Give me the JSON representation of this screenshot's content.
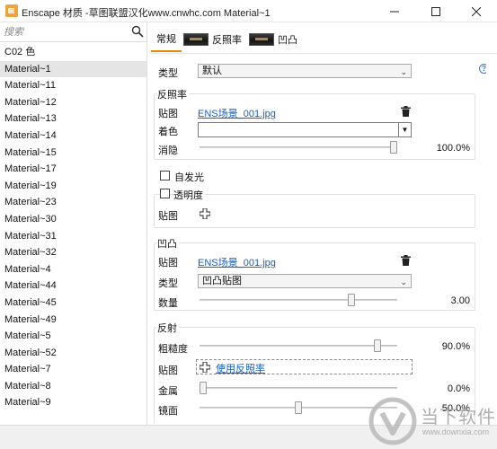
{
  "window": {
    "title": "Enscape 材质 -草图联盟汉化www.cnwhc.com Material~1"
  },
  "search": {
    "placeholder": "搜索"
  },
  "materials": [
    "C02 色",
    "Material~1",
    "Material~11",
    "Material~12",
    "Material~13",
    "Material~14",
    "Material~15",
    "Material~17",
    "Material~19",
    "Material~23",
    "Material~30",
    "Material~31",
    "Material~32",
    "Material~4",
    "Material~44",
    "Material~45",
    "Material~49",
    "Material~5",
    "Material~52",
    "Material~7",
    "Material~8",
    "Material~9"
  ],
  "selected_material": "Material~1",
  "tabs": {
    "general": "常规",
    "reflectivity": "反照率",
    "bump": "凹凸"
  },
  "type_row": {
    "label": "类型",
    "value": "默认"
  },
  "albedo": {
    "title": "反照率",
    "texture_label": "贴图",
    "texture_file": "ENS场景_001.jpg",
    "tint_label": "着色",
    "fade_label": "消隐",
    "fade_value": "100.0%",
    "fade_level": 1.0
  },
  "self_illumination": {
    "label": "自发光"
  },
  "transparency": {
    "label": "透明度",
    "texture_label": "贴图"
  },
  "bump": {
    "title": "凹凸",
    "texture_label": "贴图",
    "texture_file": "ENS场景_001.jpg",
    "type_label": "类型",
    "type_value": "凹凸贴图",
    "amount_label": "数量",
    "amount_value": "3.00",
    "amount_level": 0.77
  },
  "reflection": {
    "title": "反射",
    "roughness_label": "粗糙度",
    "roughness_value": "90.0%",
    "roughness_level": 0.9,
    "texture_label": "贴图",
    "use_albedo": "使用反照率",
    "metallic_label": "金属",
    "metallic_value": "0.0%",
    "metallic_level": 0.0,
    "specular_label": "镜面",
    "specular_value": "50.0%",
    "specular_level": 0.5
  },
  "watermark": {
    "text": "当下软件园",
    "url": "www.downxia.com"
  },
  "colors": {
    "accent_tab": "#e58a00",
    "link": "#1a5fc2",
    "selection": "#e5e5e5"
  }
}
